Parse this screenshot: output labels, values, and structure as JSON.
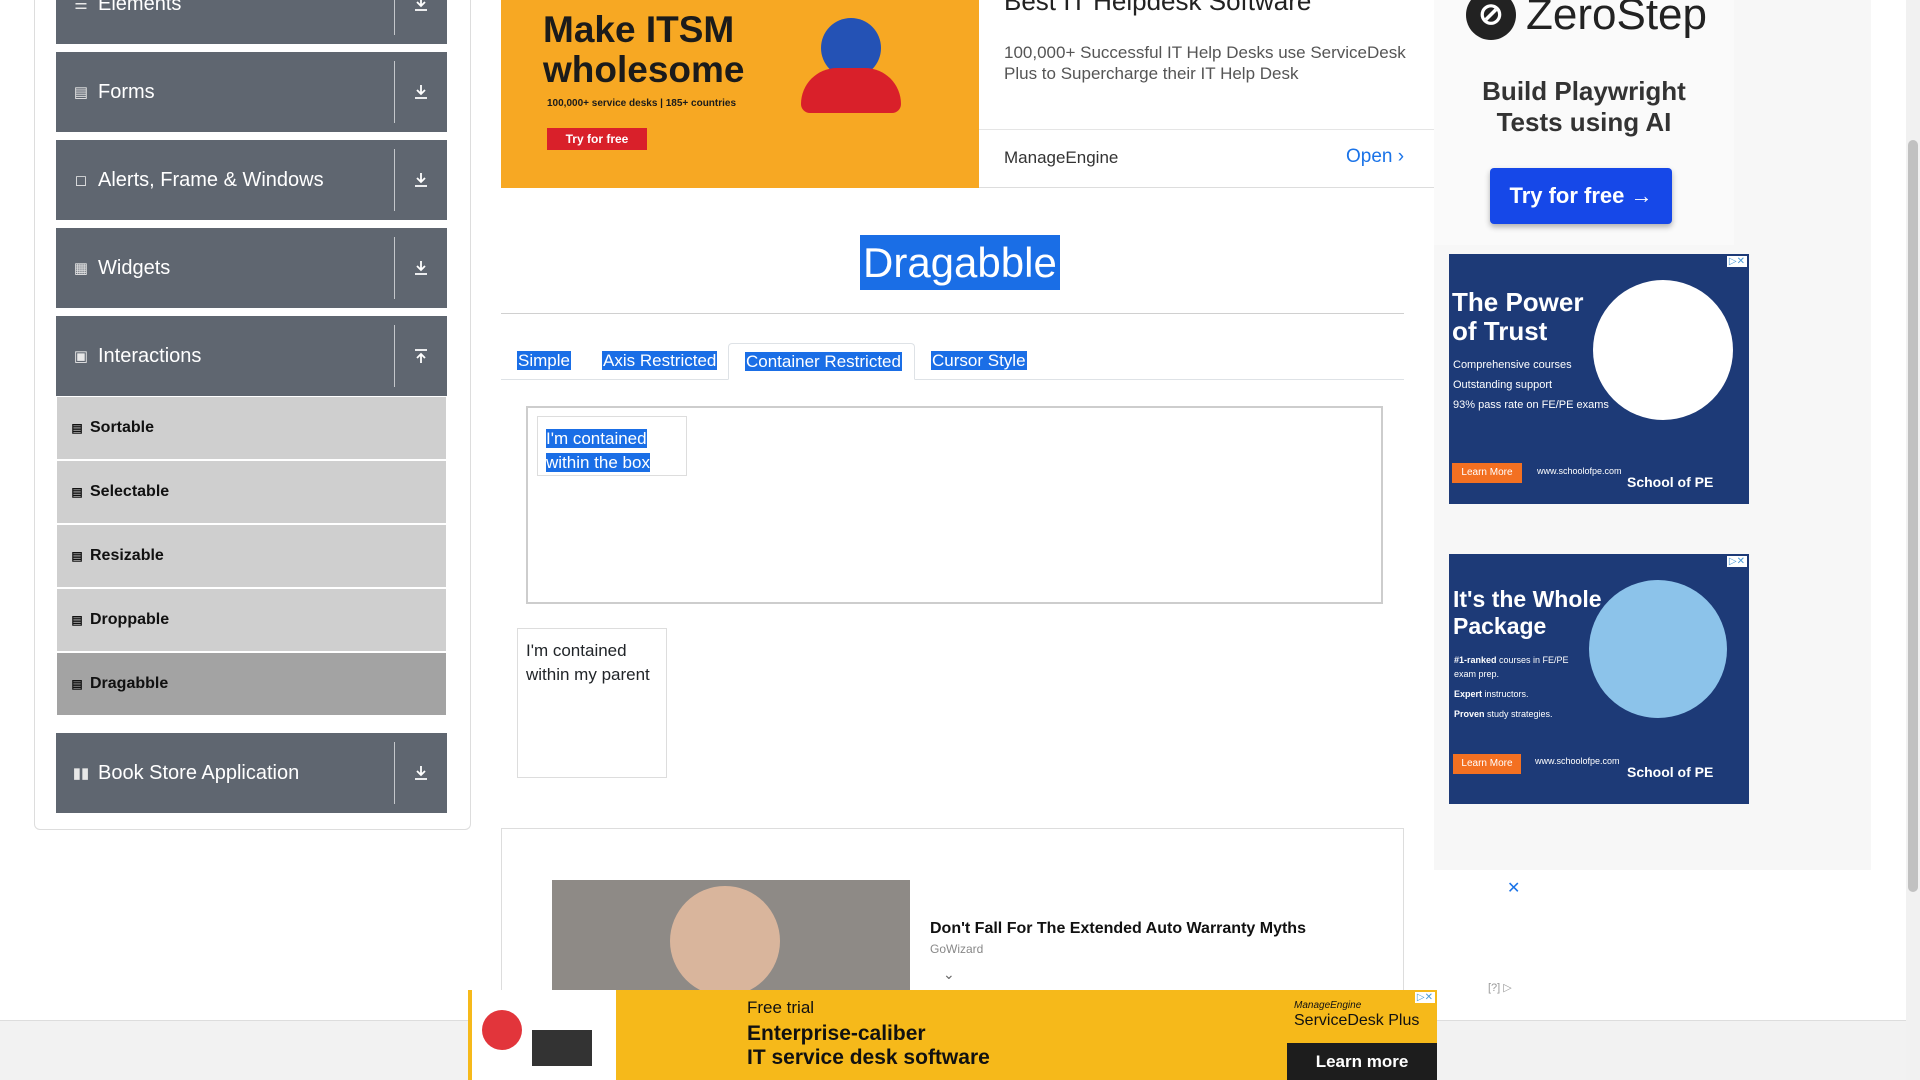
{
  "sidebar": {
    "groups": [
      {
        "label": "Elements",
        "icon": "menu-icon"
      },
      {
        "label": "Forms",
        "icon": "form-icon"
      },
      {
        "label": "Alerts, Frame & Windows",
        "icon": "window-icon"
      },
      {
        "label": "Widgets",
        "icon": "widgets-icon"
      },
      {
        "label": "Interactions",
        "icon": "interactions-icon"
      },
      {
        "label": "Book Store Application",
        "icon": "books-icon"
      }
    ],
    "interaction_items": [
      "Sortable",
      "Selectable",
      "Resizable",
      "Droppable",
      "Dragabble"
    ],
    "active_item": "Dragabble"
  },
  "main": {
    "title": "Dragabble",
    "tabs": [
      "Simple",
      "Axis Restricted",
      "Container Restricted",
      "Cursor Style"
    ],
    "active_tab": "Container Restricted",
    "box_drag_lines": [
      "I'm contained",
      "within the box"
    ],
    "parent_drag_lines": [
      "I'm contained",
      "within my parent"
    ]
  },
  "ad_top": {
    "headline_lines": [
      "Make ITSM",
      "wholesome"
    ],
    "sub": "100,000+ service desks | 185+ countries",
    "cta": "Try for free",
    "title": "Best IT Helpdesk Software",
    "desc": "100,000+ Successful IT Help Desks use ServiceDesk Plus to Supercharge their IT Help Desk",
    "brand": "ManageEngine",
    "open": "Open"
  },
  "ad_zerostep": {
    "brand": "ZeroStep",
    "line1": "Build Playwright",
    "line2": "Tests using AI",
    "cta": "Try for free →"
  },
  "ad_pe1": {
    "title_lines": [
      "The Power",
      "of Trust"
    ],
    "bullets": [
      "Comprehensive courses",
      "Outstanding support",
      "93% pass rate on FE/PE exams"
    ],
    "cta": "Learn More",
    "url": "www.schoolofpe.com",
    "brand": "School of PE"
  },
  "ad_pe2": {
    "title_lines": [
      "It's the Whole",
      "Package"
    ],
    "lines": [
      {
        "b": "#1-ranked",
        "t": " courses in FE/PE exam prep."
      },
      {
        "b": "Expert",
        "t": " instructors."
      },
      {
        "b": "Proven",
        "t": " study strategies."
      }
    ],
    "cta": "Learn More",
    "url": "www.schoolofpe.com",
    "brand": "School of PE"
  },
  "native_ad": {
    "headline": "Don't Fall For The Extended Auto Warranty Myths",
    "source": "GoWizard"
  },
  "sticky_ad": {
    "line1": "Free trial",
    "line2": "Enterprise-caliber",
    "line3": "IT service desk software",
    "brand_small": "ManageEngine",
    "brand": "ServiceDesk Plus",
    "cta": "Learn more"
  },
  "colors": {
    "header": "#5f6670",
    "selection": "#1a6ee6",
    "menu": "#cfcfcf",
    "menu_active": "#a3a3a3"
  }
}
